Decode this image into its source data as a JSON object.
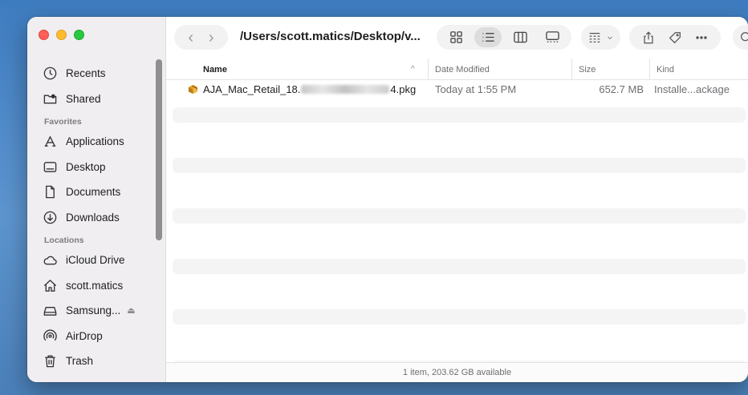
{
  "sidebar": {
    "recents": "Recents",
    "shared": "Shared",
    "favorites_header": "Favorites",
    "favorites": [
      "Applications",
      "Desktop",
      "Documents",
      "Downloads"
    ],
    "locations_header": "Locations",
    "locations": [
      "iCloud Drive",
      "scott.matics",
      "Samsung...",
      "AirDrop",
      "Trash"
    ]
  },
  "toolbar": {
    "back_icon": "chevron-left-icon",
    "forward_icon": "chevron-right-icon",
    "path_title": "/Users/scott.matics/Desktop/v...",
    "views": [
      "icon-view",
      "list-view",
      "column-view",
      "gallery-view"
    ],
    "active_view": "list-view"
  },
  "columns": {
    "name": "Name",
    "date": "Date Modified",
    "size": "Size",
    "kind": "Kind"
  },
  "files": [
    {
      "name_prefix": "AJA_Mac_Retail_18.",
      "name_suffix": "4.pkg",
      "date": "Today at 1:55 PM",
      "size": "652.7 MB",
      "kind": "Installe...ackage"
    }
  ],
  "status": "1 item, 203.62 GB available",
  "colors": {
    "close": "#ff5f57",
    "minimize": "#febc2e",
    "zoom": "#28c840"
  }
}
